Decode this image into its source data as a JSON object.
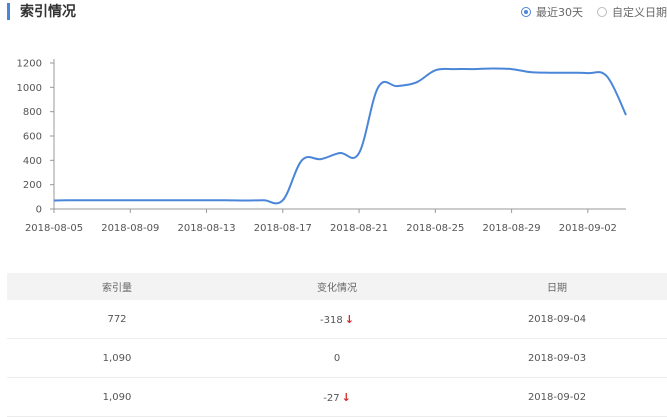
{
  "header": {
    "title": "索引情况",
    "range_options": [
      {
        "label": "最近30天",
        "checked": true
      },
      {
        "label": "自定义日期",
        "checked": false
      }
    ],
    "accent_color": "#4a86d8"
  },
  "chart_data": {
    "type": "line",
    "xlabel": "",
    "ylabel": "",
    "ylim": [
      0,
      1200
    ],
    "yticks": [
      0,
      200,
      400,
      600,
      800,
      1000,
      1200
    ],
    "x_tick_labels": [
      "2018-08-05",
      "2018-08-09",
      "2018-08-13",
      "2018-08-17",
      "2018-08-21",
      "2018-08-25",
      "2018-08-29",
      "2018-09-02"
    ],
    "grid": false,
    "line_color": "#4a86d8",
    "x": [
      "2018-08-05",
      "2018-08-06",
      "2018-08-07",
      "2018-08-08",
      "2018-08-09",
      "2018-08-10",
      "2018-08-11",
      "2018-08-12",
      "2018-08-13",
      "2018-08-14",
      "2018-08-15",
      "2018-08-16",
      "2018-08-17",
      "2018-08-18",
      "2018-08-19",
      "2018-08-20",
      "2018-08-21",
      "2018-08-22",
      "2018-08-23",
      "2018-08-24",
      "2018-08-25",
      "2018-08-26",
      "2018-08-27",
      "2018-08-28",
      "2018-08-29",
      "2018-08-30",
      "2018-08-31",
      "2018-09-01",
      "2018-09-02",
      "2018-09-03",
      "2018-09-04"
    ],
    "series": [
      {
        "values": [
          70,
          72,
          72,
          72,
          72,
          72,
          72,
          72,
          72,
          72,
          70,
          72,
          72,
          400,
          410,
          460,
          460,
          1000,
          1010,
          1040,
          1140,
          1150,
          1150,
          1155,
          1150,
          1125,
          1120,
          1120,
          1117,
          1090,
          772
        ]
      }
    ]
  },
  "table": {
    "headers": [
      "索引量",
      "变化情况",
      "日期"
    ],
    "rows": [
      {
        "count": "772",
        "change": "-318",
        "down": true,
        "date": "2018-09-04"
      },
      {
        "count": "1,090",
        "change": "0",
        "down": false,
        "date": "2018-09-03"
      },
      {
        "count": "1,090",
        "change": "-27",
        "down": true,
        "date": "2018-09-02"
      }
    ],
    "down_color": "#d32a2a"
  }
}
